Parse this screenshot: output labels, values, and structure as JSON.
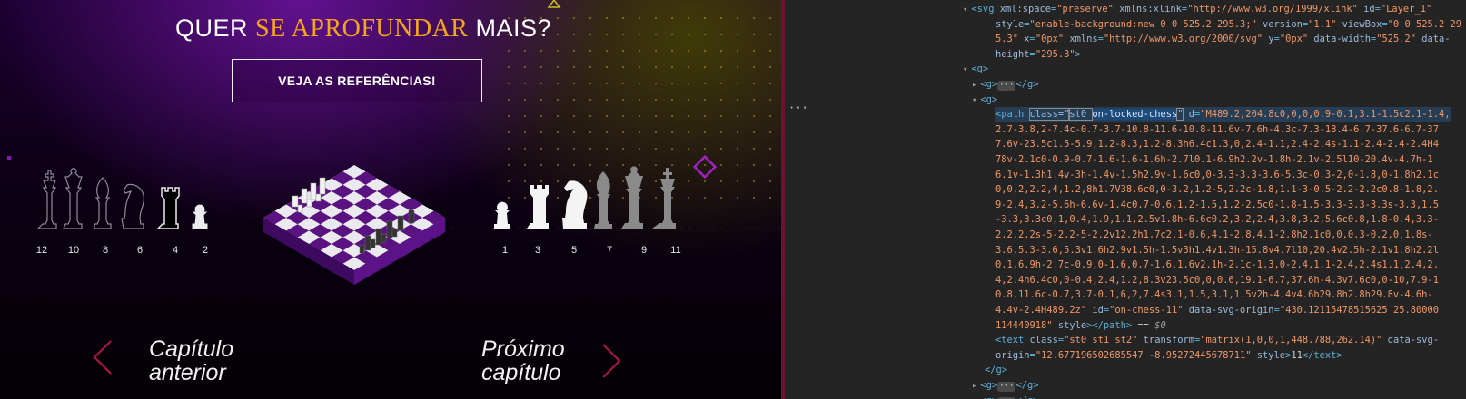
{
  "headline": {
    "pre": "QUER ",
    "highlight": "SE APROFUNDAR",
    "post": " MAIS?"
  },
  "cta": {
    "label": "VEJA AS REFERÊNCIAS!"
  },
  "left_pieces": [
    "12",
    "10",
    "8",
    "6",
    "4",
    "2"
  ],
  "right_pieces": [
    "1",
    "3",
    "5",
    "7",
    "9",
    "11"
  ],
  "nav": {
    "prev_line1": "Capítulo",
    "prev_line2": "anterior",
    "next_line1": "Próximo",
    "next_line2": "capítulo"
  },
  "colors": {
    "accent": "#f3a51c",
    "purple": "#5a1280",
    "nav_arrow": "#b01548"
  },
  "devtools": {
    "lines": [
      {
        "id": "l0",
        "parts": [
          [
            "tri",
            "▾"
          ],
          [
            "tag",
            "<svg "
          ],
          [
            "attr",
            "xml:space"
          ],
          [
            "tag",
            "="
          ],
          [
            "val",
            "\"preserve\""
          ],
          [
            "attr",
            " xmlns:xlink"
          ],
          [
            "tag",
            "="
          ],
          [
            "val",
            "\"http://www.w3.org/1999/xlink\""
          ],
          [
            "attr",
            " id"
          ],
          [
            "tag",
            "="
          ],
          [
            "val",
            "\"Layer_1\""
          ]
        ]
      },
      {
        "id": "l1",
        "parts": [
          [
            "attr",
            "style"
          ],
          [
            "tag",
            "="
          ],
          [
            "val",
            "\"enable-background:new 0 0 525.2 295.3;\""
          ],
          [
            "attr",
            " version"
          ],
          [
            "tag",
            "="
          ],
          [
            "val",
            "\"1.1\""
          ],
          [
            "attr",
            " viewBox"
          ],
          [
            "tag",
            "="
          ],
          [
            "val",
            "\"0 0 525.2 29"
          ]
        ]
      },
      {
        "id": "l2",
        "parts": [
          [
            "val",
            "5.3\""
          ],
          [
            "attr",
            " x"
          ],
          [
            "tag",
            "="
          ],
          [
            "val",
            "\"0px\""
          ],
          [
            "attr",
            " xmlns"
          ],
          [
            "tag",
            "="
          ],
          [
            "val",
            "\"http://www.w3.org/2000/svg\""
          ],
          [
            "attr",
            " y"
          ],
          [
            "tag",
            "="
          ],
          [
            "val",
            "\"0px\""
          ],
          [
            "attr",
            " data-width"
          ],
          [
            "tag",
            "="
          ],
          [
            "val",
            "\"525.2\""
          ],
          [
            "attr",
            " data-"
          ]
        ]
      },
      {
        "id": "l3",
        "parts": [
          [
            "attr",
            "height"
          ],
          [
            "tag",
            "="
          ],
          [
            "val",
            "\"295.3\""
          ],
          [
            "tag",
            ">"
          ]
        ]
      },
      {
        "id": "l4",
        "parts": [
          [
            "tri",
            "▾"
          ],
          [
            "tag",
            "<g>"
          ]
        ]
      },
      {
        "id": "l5",
        "parts": [
          [
            "tri",
            "▸"
          ],
          [
            "tag",
            "<g>"
          ],
          [
            "ellip",
            "···"
          ],
          [
            "tag",
            "</g>"
          ]
        ]
      },
      {
        "id": "l6",
        "parts": [
          [
            "tri",
            "▾"
          ],
          [
            "tag",
            "<g>"
          ]
        ]
      },
      {
        "id": "l7",
        "parts": [
          [
            "tag",
            "<path "
          ],
          [
            "box",
            "class=\""
          ],
          [
            "box2",
            "st0 "
          ],
          [
            "hl",
            "on-locked-chess"
          ],
          [
            "box",
            "\""
          ],
          [
            "attr",
            " d"
          ],
          [
            "tag",
            "="
          ],
          [
            "val",
            "\"M489.2,204.8c0,0,0,0.9-0.1,3.1-1.5c2.1-1.4,"
          ]
        ]
      },
      {
        "id": "l8",
        "parts": [
          [
            "val",
            "2.7-3.8,2-7.4c-0.7-3.7-10.8-11.6-10.8-11.6v-7.6h-4.3c-7.3-18.4-6.7-37.6-6.7-37"
          ]
        ]
      },
      {
        "id": "l9",
        "parts": [
          [
            "val",
            "7.6v-23.5c1.5-5.9,1.2-8.3,1.2-8.3h6.4c1.3,0,2.4-1.1,2.4-2.4s-1.1-2.4-2.4-2.4H4"
          ]
        ]
      },
      {
        "id": "l10",
        "parts": [
          [
            "val",
            "78v-2.1c0-0.9-0.7-1.6-1.6-1.6h-2.7l0.1-6.9h2.2v-1.8h-2.1v-2.5l10-20.4v-4.7h-1"
          ]
        ]
      },
      {
        "id": "l11",
        "parts": [
          [
            "val",
            "6.1v-1.3h1.4v-3h-1.4v-1.5h2.9v-1.6c0,0-3.3-3.3-3.6-5.3c-0.3-2,0-1.8,0-1.8h2.1c"
          ]
        ]
      },
      {
        "id": "l12",
        "parts": [
          [
            "val",
            "0,0,2,2.2,4,1.2,8h1.7V38.6c0,0-3.2,1.2-5,2.2c-1.8,1.1-3-0.5-2.2-2.2c0.8-1.8,2."
          ]
        ]
      },
      {
        "id": "l13",
        "parts": [
          [
            "val",
            "9-2.4,3.2-5.6h-6.6v-1.4c0.7-0.6,1.2-1.5,1.2-2.5c0-1.8-1.5-3.3-3.3-3.3s-3.3,1.5"
          ]
        ]
      },
      {
        "id": "l14",
        "parts": [
          [
            "val",
            "-3.3,3.3c0,1,0.4,1.9,1.1,2.5v1.8h-6.6c0.2,3.2,2.4,3.8,3.2,5.6c0.8,1.8-0.4,3.3-"
          ]
        ]
      },
      {
        "id": "l15",
        "parts": [
          [
            "val",
            "2.2,2.2s-5-2.2-5-2.2v12.2h1.7c2.1-0.6,4.1-2.8,4.1-2.8h2.1c0,0,0.3-0.2,0,1.8s-"
          ]
        ]
      },
      {
        "id": "l16",
        "parts": [
          [
            "val",
            "3.6,5.3-3.6,5.3v1.6h2.9v1.5h-1.5v3h1.4v1.3h-15.8v4.7l10,20.4v2.5h-2.1v1.8h2.2l"
          ]
        ]
      },
      {
        "id": "l17",
        "parts": [
          [
            "val",
            "0.1,6.9h-2.7c-0.9,0-1.6,0.7-1.6,1.6v2.1h-2.1c-1.3,0-2.4,1.1-2.4,2.4s1.1,2.4,2."
          ]
        ]
      },
      {
        "id": "l18",
        "parts": [
          [
            "val",
            "4,2.4h6.4c0,0-0.4,2.4,1.2,8.3v23.5c0,0,0.6,19.1-6.7,37.6h-4.3v7.6c0,0-10,7.9-1"
          ]
        ]
      },
      {
        "id": "l19",
        "parts": [
          [
            "val",
            "0.8,11.6c-0.7,3.7-0.1,6,2,7.4s3.1,1.5,3.1,1.5v2h-4.4v4.6h29.8h2.8h29.8v-4.6h-"
          ]
        ]
      },
      {
        "id": "l20",
        "parts": [
          [
            "val",
            "4.4v-2.4H489.2z\""
          ],
          [
            "attr",
            " id"
          ],
          [
            "tag",
            "="
          ],
          [
            "val",
            "\"on-chess-11\""
          ],
          [
            "attr",
            " data-svg-origin"
          ],
          [
            "tag",
            "="
          ],
          [
            "val",
            "\"430.12115478515625 25.80000"
          ]
        ]
      },
      {
        "id": "l21",
        "parts": [
          [
            "val",
            "114440918\""
          ],
          [
            "attr",
            " style"
          ],
          [
            "tag",
            ">"
          ],
          [
            "tag",
            "</path>"
          ],
          [
            "txt",
            " == "
          ],
          [
            "em",
            "$0"
          ]
        ]
      },
      {
        "id": "l22",
        "parts": [
          [
            "tag",
            "<text "
          ],
          [
            "attr",
            "class"
          ],
          [
            "tag",
            "="
          ],
          [
            "val",
            "\"st0 st1 st2\""
          ],
          [
            "attr",
            " transform"
          ],
          [
            "tag",
            "="
          ],
          [
            "val",
            "\"matrix(1,0,0,1,448.788,262.14)\""
          ],
          [
            "attr",
            " data-svg-"
          ]
        ]
      },
      {
        "id": "l23",
        "parts": [
          [
            "attr",
            "origin"
          ],
          [
            "tag",
            "="
          ],
          [
            "val",
            "\"12.677196502685547 -8.95272445678711\""
          ],
          [
            "attr",
            " style"
          ],
          [
            "tag",
            ">"
          ],
          [
            "txt",
            "11"
          ],
          [
            "tag",
            "</text>"
          ]
        ]
      },
      {
        "id": "l24",
        "parts": [
          [
            "tag",
            "</g>"
          ]
        ]
      },
      {
        "id": "l25",
        "parts": [
          [
            "tri",
            "▸"
          ],
          [
            "tag",
            "<g>"
          ],
          [
            "ellip",
            "···"
          ],
          [
            "tag",
            "</g>"
          ]
        ]
      },
      {
        "id": "l26",
        "parts": [
          [
            "tri",
            "▸"
          ],
          [
            "tag",
            "<g>"
          ],
          [
            "ellip",
            "···"
          ],
          [
            "tag",
            "</g>"
          ]
        ]
      }
    ],
    "gutter_dots": "···"
  }
}
